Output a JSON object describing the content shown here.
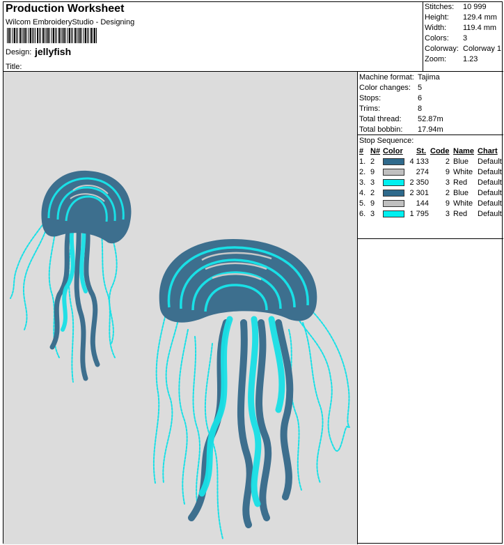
{
  "header": {
    "title": "Production Worksheet",
    "software": "Wilcom EmbroideryStudio - Designing",
    "design_label": "Design:",
    "design_name": "jellyfish",
    "title_label": "Title:"
  },
  "stats": [
    {
      "label": "Stitches:",
      "value": "10 999"
    },
    {
      "label": "Height:",
      "value": "129.4 mm"
    },
    {
      "label": "Width:",
      "value": "119.4 mm"
    },
    {
      "label": "Colors:",
      "value": "3"
    },
    {
      "label": "Colorway:",
      "value": "Colorway 1"
    },
    {
      "label": "Zoom:",
      "value": "1.23"
    }
  ],
  "machine": [
    {
      "label": "Machine format:",
      "value": "Tajima"
    },
    {
      "label": "Color changes:",
      "value": "5"
    },
    {
      "label": "Stops:",
      "value": "6"
    },
    {
      "label": "Trims:",
      "value": "8"
    },
    {
      "label": "Total thread:",
      "value": "52.87m"
    },
    {
      "label": "Total bobbin:",
      "value": "17.94m"
    }
  ],
  "stop_sequence": {
    "title": "Stop Sequence:",
    "columns": {
      "num": "#",
      "needle": "N#",
      "color": "Color",
      "stitches": "St.",
      "code": "Code",
      "name": "Name",
      "chart": "Chart"
    },
    "rows": [
      {
        "num": "1.",
        "needle": "2",
        "color": "#2f6a8c",
        "stitches": "4 133",
        "code": "2",
        "name": "Blue",
        "chart": "Default"
      },
      {
        "num": "2.",
        "needle": "9",
        "color": "#c0c0c0",
        "stitches": "274",
        "code": "9",
        "name": "White",
        "chart": "Default"
      },
      {
        "num": "3.",
        "needle": "3",
        "color": "#00f0f0",
        "stitches": "2 350",
        "code": "3",
        "name": "Red",
        "chart": "Default"
      },
      {
        "num": "4.",
        "needle": "2",
        "color": "#2f6a8c",
        "stitches": "2 301",
        "code": "2",
        "name": "Blue",
        "chart": "Default"
      },
      {
        "num": "5.",
        "needle": "9",
        "color": "#c0c0c0",
        "stitches": "144",
        "code": "9",
        "name": "White",
        "chart": "Default"
      },
      {
        "num": "6.",
        "needle": "3",
        "color": "#00f0f0",
        "stitches": "1 795",
        "code": "3",
        "name": "Red",
        "chart": "Default"
      }
    ]
  },
  "colors": {
    "canvas_bg": "#dcdcdc",
    "thread_blue": "#3d6f8e",
    "thread_white": "#c8c8c8",
    "thread_cyan": "#19e0e6"
  }
}
